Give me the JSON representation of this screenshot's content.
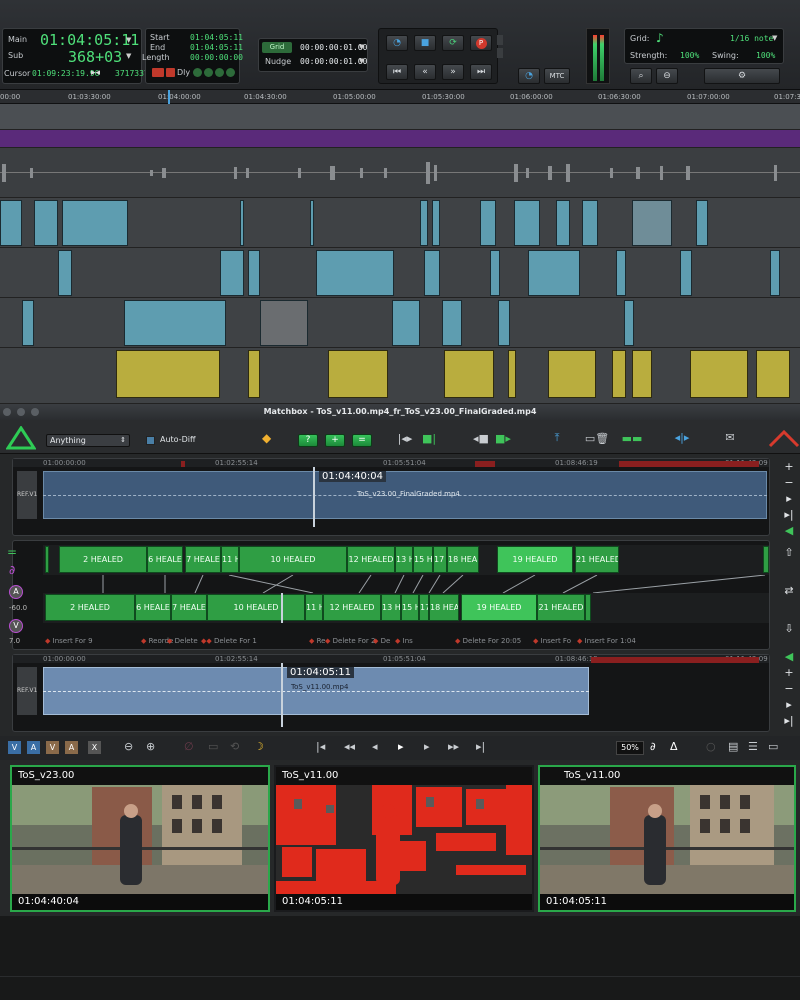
{
  "transport": {
    "main_label": "Main",
    "sub_label": "Sub",
    "cursor_label": "Cursor",
    "main_value": "01:04:05:11",
    "sub_value": "368+03",
    "cursor_value": "01:09:23:19.96",
    "sample_value": "3717337",
    "start_label": "Start",
    "end_label": "End",
    "length_label": "Length",
    "start_value": "01:04:05:11",
    "end_value": "01:04:05:11",
    "length_value": "00:00:00:00",
    "dly_label": "Dly",
    "grid_label": "Grid",
    "nudge_label": "Nudge",
    "grid_value": "00:00:00:01.00",
    "nudge_value": "00:00:00:01.00",
    "mtc_label": "MTC",
    "grid2_label": "Grid:",
    "grid_note": "1/16 note",
    "strength_label": "Strength:",
    "strength_value": "100%",
    "swing_label": "Swing:",
    "swing_value": "100%"
  },
  "ruler": {
    "ticks": [
      "00:00",
      "01:03:30:00",
      "01:04:00:00",
      "01:04:30:00",
      "01:05:00:00",
      "01:05:30:00",
      "01:06:00:00",
      "01:06:30:00",
      "01:07:00:00",
      "01:07:3"
    ]
  },
  "matchbox": {
    "title": "Matchbox - ToS_v11.00.mp4_fr_ToS_v23.00_FinalGraded.mp4",
    "mode_select": "Anything",
    "auto_diff_label": "Auto-Diff",
    "ref_top": {
      "timecode": "01:04:40:04",
      "filename": "ToS_v23.00_FinalGraded.mp4",
      "ticks": [
        "01:00:00:00",
        "01:02:55:14",
        "01:05:51:04",
        "01:08:46:19",
        "01:11:42:09"
      ],
      "track_label": "REF.V1"
    },
    "ref_bottom": {
      "timecode": "01:04:05:11",
      "filename": "ToS_v11.00.mp4",
      "ticks": [
        "01:00:00:00",
        "01:02:55:14",
        "01:05:51:04",
        "01:08:46:19",
        "01:11:42:09"
      ],
      "track_label": "REF.V1"
    },
    "a_value": "-60.0",
    "v_value": "7.0",
    "top_segments": [
      "2 HEALED",
      "6 HEALE",
      "7 HEALE",
      "11 H",
      "10 HEALED",
      "12 HEALED",
      "13 H",
      "15 HE",
      "17 H",
      "18 HEALE",
      "19 HEALED",
      "21 HEALED"
    ],
    "bottom_segments": [
      "2 HEALED",
      "6 HEALE",
      "7 HEALE",
      "10 HEALED",
      "11 H",
      "12 HEALED",
      "13 HE",
      "15 HE",
      "17 H",
      "18 HEAL",
      "19 HEALED",
      "21 HEALED"
    ],
    "markers": [
      "Insert For 9",
      "Reorde",
      "Delete",
      "Delete For 1",
      "Re",
      "Delete For 2",
      "De",
      "Ins",
      "Delete For 20:05",
      "Insert Fo",
      "Insert For 1:04"
    ],
    "track_toggles": [
      "V",
      "A",
      "V",
      "A",
      "X"
    ],
    "zoom_value": "50%"
  },
  "viewers": [
    {
      "name": "ToS_v23.00",
      "timecode": "01:04:40:04"
    },
    {
      "name": "ToS_v11.00",
      "timecode": "01:04:05:11"
    },
    {
      "name": "ToS_v11.00",
      "timecode": "01:04:05:11"
    }
  ]
}
